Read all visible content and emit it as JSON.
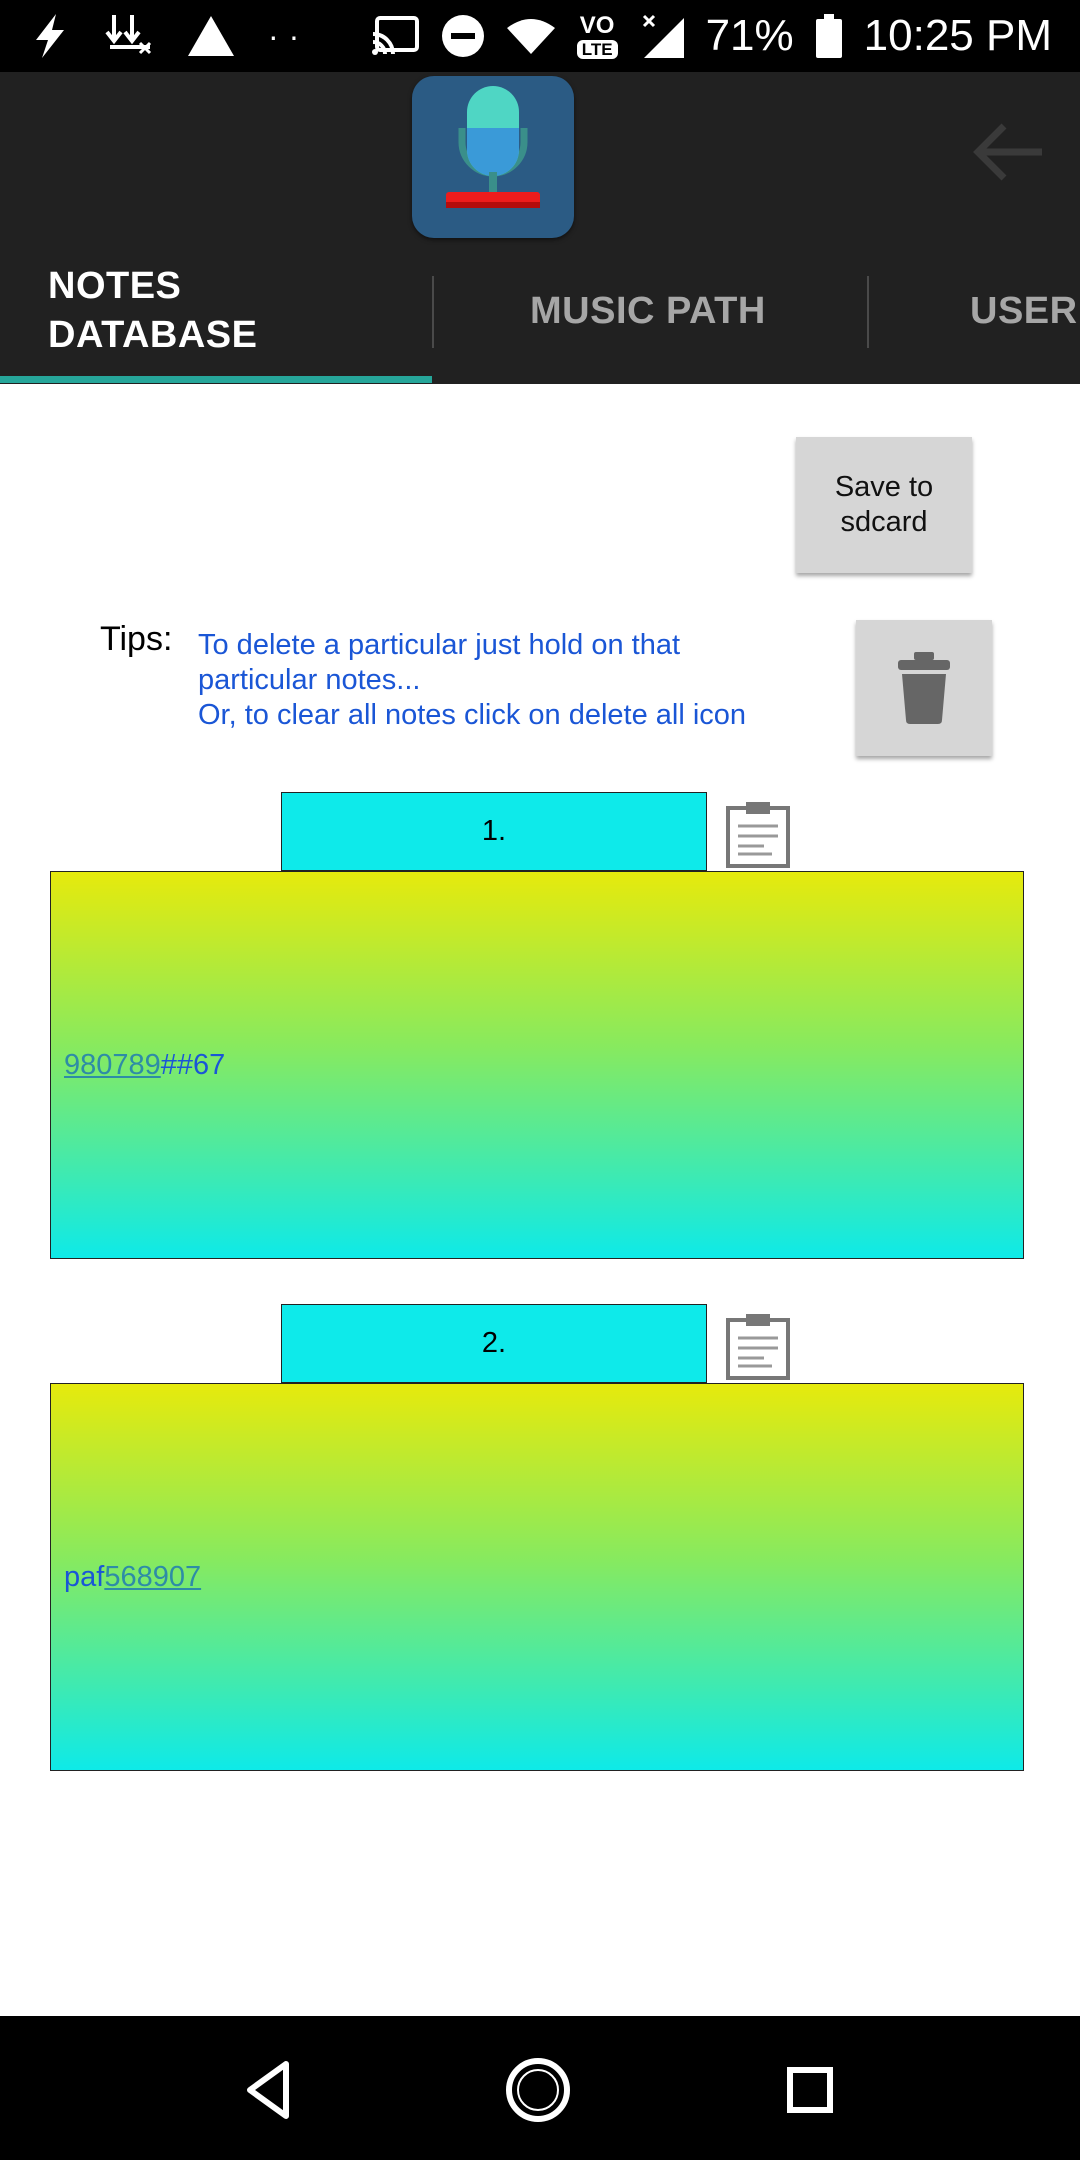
{
  "status_bar": {
    "battery_percent": "71%",
    "time": "10:25 PM",
    "network_badge": "LTE",
    "volte_label": "VO",
    "icons": [
      "flash-icon",
      "download-icon",
      "warning-icon",
      "more-dots-icon",
      "cast-icon",
      "do-not-disturb-icon",
      "wifi-icon",
      "volte-icon",
      "signal-icon",
      "battery-icon"
    ]
  },
  "header": {
    "logo_icon": "microphone-icon",
    "back_icon": "back-arrow-icon"
  },
  "tabs": [
    {
      "label_line1": "NOTES",
      "label_line2": "DATABASE",
      "active": true
    },
    {
      "label": "MUSIC PATH",
      "active": false
    },
    {
      "label": "USER",
      "active": false
    }
  ],
  "toolbar": {
    "save_label_line1": "Save to",
    "save_label_line2": "sdcard",
    "delete_icon": "trash-icon"
  },
  "tips": {
    "label": "Tips:",
    "line1": "To delete a particular just hold on that",
    "line2": "particular notes...",
    "line3": "Or, to clear all notes click on delete all icon"
  },
  "notes": [
    {
      "number": "1.",
      "text_link": "980789",
      "text_rest": "##67"
    },
    {
      "number": "2.",
      "text_prefix": "paf",
      "text_link": "568907"
    }
  ],
  "colors": {
    "accent": "#26a69a",
    "header_bg": "#212121",
    "note_header_bg": "#0eeaea",
    "note_gradient_top": "#e6ea0c",
    "note_gradient_bottom": "#0eeae8",
    "tips_text": "#1a56d6"
  }
}
